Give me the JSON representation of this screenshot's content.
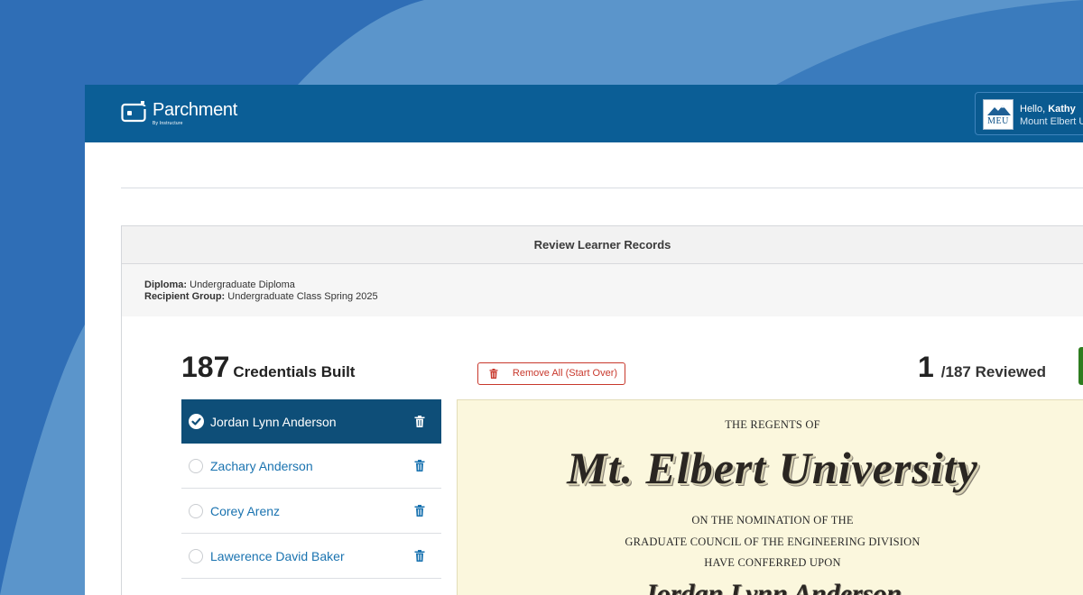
{
  "brand": {
    "name": "Parchment",
    "byline": "By Instructure"
  },
  "user": {
    "greeting": "Hello,",
    "name": "Kathy",
    "institution": "Mount Elbert U",
    "avatar_abbr": "MEU"
  },
  "panel": {
    "title": "Review Learner Records",
    "diploma_label": "Diploma:",
    "diploma_value": "Undergraduate Diploma",
    "group_label": "Recipient Group:",
    "group_value": "Undergraduate Class Spring 2025"
  },
  "summary": {
    "built_count": "187",
    "built_label": "Credentials Built",
    "remove_all_label": "Remove All (Start Over)",
    "reviewed_count": "1",
    "reviewed_label": "/187 Reviewed"
  },
  "learners": [
    {
      "name": "Jordan Lynn Anderson",
      "selected": true
    },
    {
      "name": "Zachary Anderson",
      "selected": false
    },
    {
      "name": "Corey Arenz",
      "selected": false
    },
    {
      "name": "Lawerence David Baker",
      "selected": false
    }
  ],
  "diploma_preview": {
    "line1": "THE REGENTS OF",
    "university": "Mt. Elbert University",
    "line2": "ON THE NOMINATION OF THE",
    "line3": "GRADUATE COUNCIL OF THE ENGINEERING DIVISION",
    "line4": "HAVE CONFERRED UPON",
    "recipient": "Jordan Lynn Anderson"
  },
  "colors": {
    "background": "#2f6eb6",
    "header": "#0b5e96",
    "selected_row": "#0e4e78",
    "link": "#1a73b0",
    "danger": "#c8382c",
    "diploma_paper": "#fbf7dd"
  }
}
